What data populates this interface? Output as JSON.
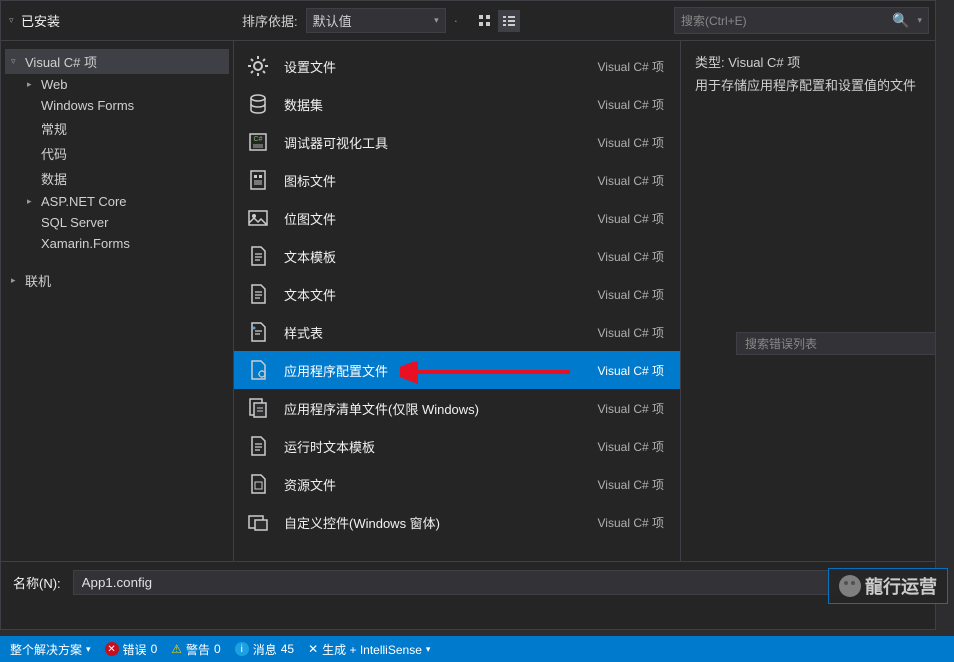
{
  "header": {
    "installed_tab": "已安装",
    "sort_label": "排序依据:",
    "sort_value": "默认值",
    "search_placeholder": "搜索(Ctrl+E)"
  },
  "tree": [
    {
      "level": 0,
      "exp": "▿",
      "label": "Visual C# 项",
      "selected": true
    },
    {
      "level": 1,
      "exp": "▸",
      "label": "Web"
    },
    {
      "level": 1,
      "exp": "",
      "label": "Windows Forms"
    },
    {
      "level": 1,
      "exp": "",
      "label": "常规"
    },
    {
      "level": 1,
      "exp": "",
      "label": "代码"
    },
    {
      "level": 1,
      "exp": "",
      "label": "数据"
    },
    {
      "level": 1,
      "exp": "▸",
      "label": "ASP.NET Core"
    },
    {
      "level": 1,
      "exp": "",
      "label": "SQL Server"
    },
    {
      "level": 1,
      "exp": "",
      "label": "Xamarin.Forms"
    },
    {
      "level": 0,
      "exp": "▸",
      "label": "联机"
    }
  ],
  "items": [
    {
      "icon": "gear",
      "name": "设置文件",
      "tag": "Visual C# 项"
    },
    {
      "icon": "db",
      "name": "数据集",
      "tag": "Visual C# 项"
    },
    {
      "icon": "debug",
      "name": "调试器可视化工具",
      "tag": "Visual C# 项"
    },
    {
      "icon": "icon-file",
      "name": "图标文件",
      "tag": "Visual C# 项"
    },
    {
      "icon": "image",
      "name": "位图文件",
      "tag": "Visual C# 项"
    },
    {
      "icon": "doc",
      "name": "文本模板",
      "tag": "Visual C# 项"
    },
    {
      "icon": "doc",
      "name": "文本文件",
      "tag": "Visual C# 项"
    },
    {
      "icon": "style",
      "name": "样式表",
      "tag": "Visual C# 项"
    },
    {
      "icon": "config",
      "name": "应用程序配置文件",
      "tag": "Visual C# 项",
      "selected": true
    },
    {
      "icon": "manifest",
      "name": "应用程序清单文件(仅限 Windows)",
      "tag": "Visual C# 项"
    },
    {
      "icon": "doc",
      "name": "运行时文本模板",
      "tag": "Visual C# 项"
    },
    {
      "icon": "resource",
      "name": "资源文件",
      "tag": "Visual C# 项"
    },
    {
      "icon": "custom",
      "name": "自定义控件(Windows 窗体)",
      "tag": "Visual C# 项"
    }
  ],
  "detail": {
    "type_label": "类型:",
    "type_value": "Visual C# 项",
    "desc": "用于存储应用程序配置和设置值的文件"
  },
  "name_row": {
    "label": "名称(N):",
    "value": "App1.config"
  },
  "watermark": "龍行运营",
  "status": {
    "scope": "整个解决方案",
    "errors_label": "错误",
    "errors": "0",
    "warnings_label": "警告",
    "warnings": "0",
    "messages_label": "消息",
    "messages": "45",
    "build": "生成 + IntelliSense"
  },
  "err_panel_placeholder": "搜索错误列表"
}
